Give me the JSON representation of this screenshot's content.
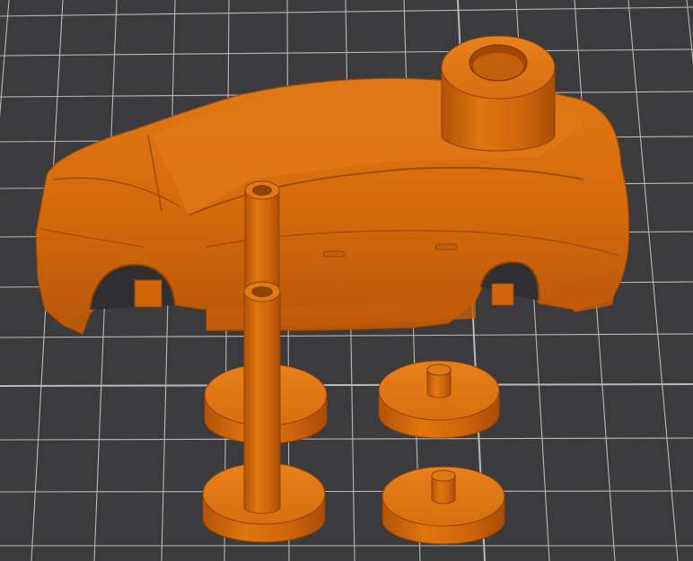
{
  "scene": {
    "type": "3d-print-slicer-preview",
    "background_color": "#3b3b3d",
    "grid_color": "#d9d9d9",
    "model_color": "#d86a0e",
    "parts": [
      {
        "name": "car-body",
        "kind": "car shell model"
      },
      {
        "name": "tube-spacer",
        "kind": "hollow cylinder"
      },
      {
        "name": "axle-rod-upper",
        "kind": "tall hollow rod"
      },
      {
        "name": "axle-rod-lower",
        "kind": "tall hollow rod"
      },
      {
        "name": "wheel-front-left",
        "kind": "disc wheel"
      },
      {
        "name": "wheel-front-right",
        "kind": "disc wheel with hub"
      },
      {
        "name": "wheel-rear-left",
        "kind": "disc wheel"
      },
      {
        "name": "wheel-rear-right",
        "kind": "disc wheel with hub"
      }
    ]
  }
}
